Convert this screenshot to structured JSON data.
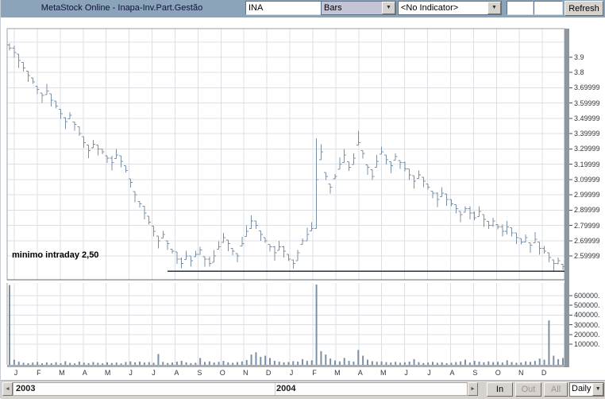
{
  "toolbar": {
    "title": "MetaStock Online - Inapa-Inv.Part.Gestão",
    "symbol_value": "INA",
    "chart_type_value": "Bars",
    "indicator_value": "<No Indicator>",
    "refresh_label": "Refresh"
  },
  "annotation": "minimo intraday 2,50",
  "price_axis": {
    "labels": [
      "3.9",
      "3.8",
      "3.69999",
      "3.59999",
      "3.49999",
      "3.39999",
      "3.29999",
      "3.19999",
      "3.09999",
      "2.99999",
      "2.89999",
      "2.79999",
      "2.69999",
      "2.59999"
    ],
    "values": [
      3.9,
      3.8,
      3.7,
      3.6,
      3.5,
      3.4,
      3.3,
      3.2,
      3.1,
      3.0,
      2.9,
      2.8,
      2.7,
      2.6
    ]
  },
  "volume_axis": {
    "labels": [
      "600000.",
      "500000.",
      "400000.",
      "300000.",
      "200000.",
      "100000."
    ],
    "values": [
      600000,
      500000,
      400000,
      300000,
      200000,
      100000
    ]
  },
  "x_axis": {
    "month_labels": [
      "J",
      "F",
      "M",
      "A",
      "M",
      "J",
      "J",
      "A",
      "S",
      "O",
      "N",
      "D",
      "J",
      "F",
      "M",
      "A",
      "M",
      "J",
      "J",
      "A",
      "S",
      "O",
      "N",
      "D"
    ],
    "year_labels": [
      "2003",
      "2004"
    ]
  },
  "bottom_bar": {
    "in_label": "In",
    "out_label": "Out",
    "all_label": "All",
    "period_value": "Daily"
  },
  "colors": {
    "toolbar_bg": "#8ca4b9",
    "bar": "#7b90a4",
    "grid": "#dcdfe4",
    "trendline": "#1d3349",
    "frame": "#9aa2aa",
    "separator": "#5a646e",
    "shadow": "#8e969e",
    "tick": "#4a4f54",
    "volume_base": "#a8aeb4"
  },
  "chart_data": {
    "type": "bar",
    "title": "MetaStock Online - Inapa-Inv.Part.Gestão",
    "symbol": "INA",
    "interval": "Daily",
    "x_months": [
      "J",
      "F",
      "M",
      "A",
      "M",
      "J",
      "J",
      "A",
      "S",
      "O",
      "N",
      "D",
      "J",
      "F",
      "M",
      "A",
      "M",
      "J",
      "J",
      "A",
      "S",
      "O",
      "N",
      "D"
    ],
    "years": [
      "2003",
      "2004"
    ],
    "ylim": [
      2.44,
      4.07
    ],
    "volume_ylim": [
      0,
      730000
    ],
    "grid": true,
    "series": [
      {
        "name": "INA close",
        "values": [
          3.96,
          3.93,
          3.88,
          3.83,
          3.78,
          3.74,
          3.69,
          3.65,
          3.68,
          3.62,
          3.58,
          3.53,
          3.48,
          3.52,
          3.46,
          3.4,
          3.34,
          3.29,
          3.33,
          3.3,
          3.28,
          3.24,
          3.21,
          3.26,
          3.22,
          3.16,
          3.08,
          3.0,
          2.94,
          2.88,
          2.82,
          2.76,
          2.7,
          2.74,
          2.68,
          2.63,
          2.58,
          2.55,
          2.6,
          2.57,
          2.61,
          2.64,
          2.58,
          2.55,
          2.6,
          2.66,
          2.72,
          2.68,
          2.63,
          2.6,
          2.68,
          2.76,
          2.83,
          2.8,
          2.74,
          2.7,
          2.66,
          2.62,
          2.66,
          2.63,
          2.58,
          2.55,
          2.62,
          2.7,
          2.74,
          2.78,
          3.1,
          3.28,
          3.12,
          3.05,
          3.12,
          3.2,
          3.26,
          3.18,
          3.24,
          3.34,
          3.27,
          3.18,
          3.12,
          3.22,
          3.28,
          3.23,
          3.19,
          3.25,
          3.21,
          3.17,
          3.13,
          3.09,
          3.13,
          3.09,
          3.05,
          3.01,
          2.97,
          3.01,
          2.97,
          2.94,
          2.91,
          2.87,
          2.91,
          2.88,
          2.85,
          2.89,
          2.84,
          2.8,
          2.83,
          2.79,
          2.76,
          2.79,
          2.75,
          2.72,
          2.69,
          2.72,
          2.67,
          2.71,
          2.65,
          2.63,
          2.59,
          2.55,
          2.57,
          2.53
        ]
      }
    ],
    "bar_overrides": [
      {
        "i": 0,
        "high": 3.99
      },
      {
        "i": 37,
        "low": 2.52
      },
      {
        "i": 43,
        "low": 2.53
      },
      {
        "i": 66,
        "high": 3.37,
        "low": 2.78
      },
      {
        "i": 67,
        "high": 3.33
      },
      {
        "i": 75,
        "high": 3.42
      },
      {
        "i": 119,
        "low": 2.51
      }
    ],
    "volume": [
      700000,
      45000,
      28000,
      18000,
      14000,
      20000,
      26000,
      13000,
      21000,
      15000,
      23000,
      14000,
      31000,
      17000,
      12000,
      28000,
      19000,
      15000,
      24000,
      18000,
      13000,
      22000,
      16000,
      20000,
      12000,
      25000,
      30000,
      22000,
      28000,
      20000,
      24000,
      18000,
      95000,
      26000,
      16000,
      20000,
      28000,
      35000,
      22000,
      15000,
      18000,
      60000,
      24000,
      30000,
      20000,
      26000,
      34000,
      22000,
      18000,
      24000,
      30000,
      42000,
      90000,
      110000,
      70000,
      80000,
      60000,
      35000,
      28000,
      22000,
      25000,
      32000,
      28000,
      50000,
      35000,
      40000,
      730000,
      120000,
      90000,
      55000,
      38000,
      30000,
      60000,
      35000,
      28000,
      130000,
      80000,
      45000,
      32000,
      26000,
      30000,
      24000,
      20000,
      26000,
      18000,
      22000,
      28000,
      50000,
      24000,
      16000,
      20000,
      26000,
      18000,
      22000,
      14000,
      18000,
      24000,
      30000,
      45000,
      20000,
      35000,
      28000,
      22000,
      30000,
      24000,
      26000,
      20000,
      40000,
      24000,
      18000,
      22000,
      30000,
      26000,
      34000,
      55000,
      45000,
      390000,
      80000,
      50000,
      60000
    ],
    "support_line": {
      "price": 2.5,
      "start_index": 34,
      "label": "minimo intraday 2,50"
    }
  }
}
